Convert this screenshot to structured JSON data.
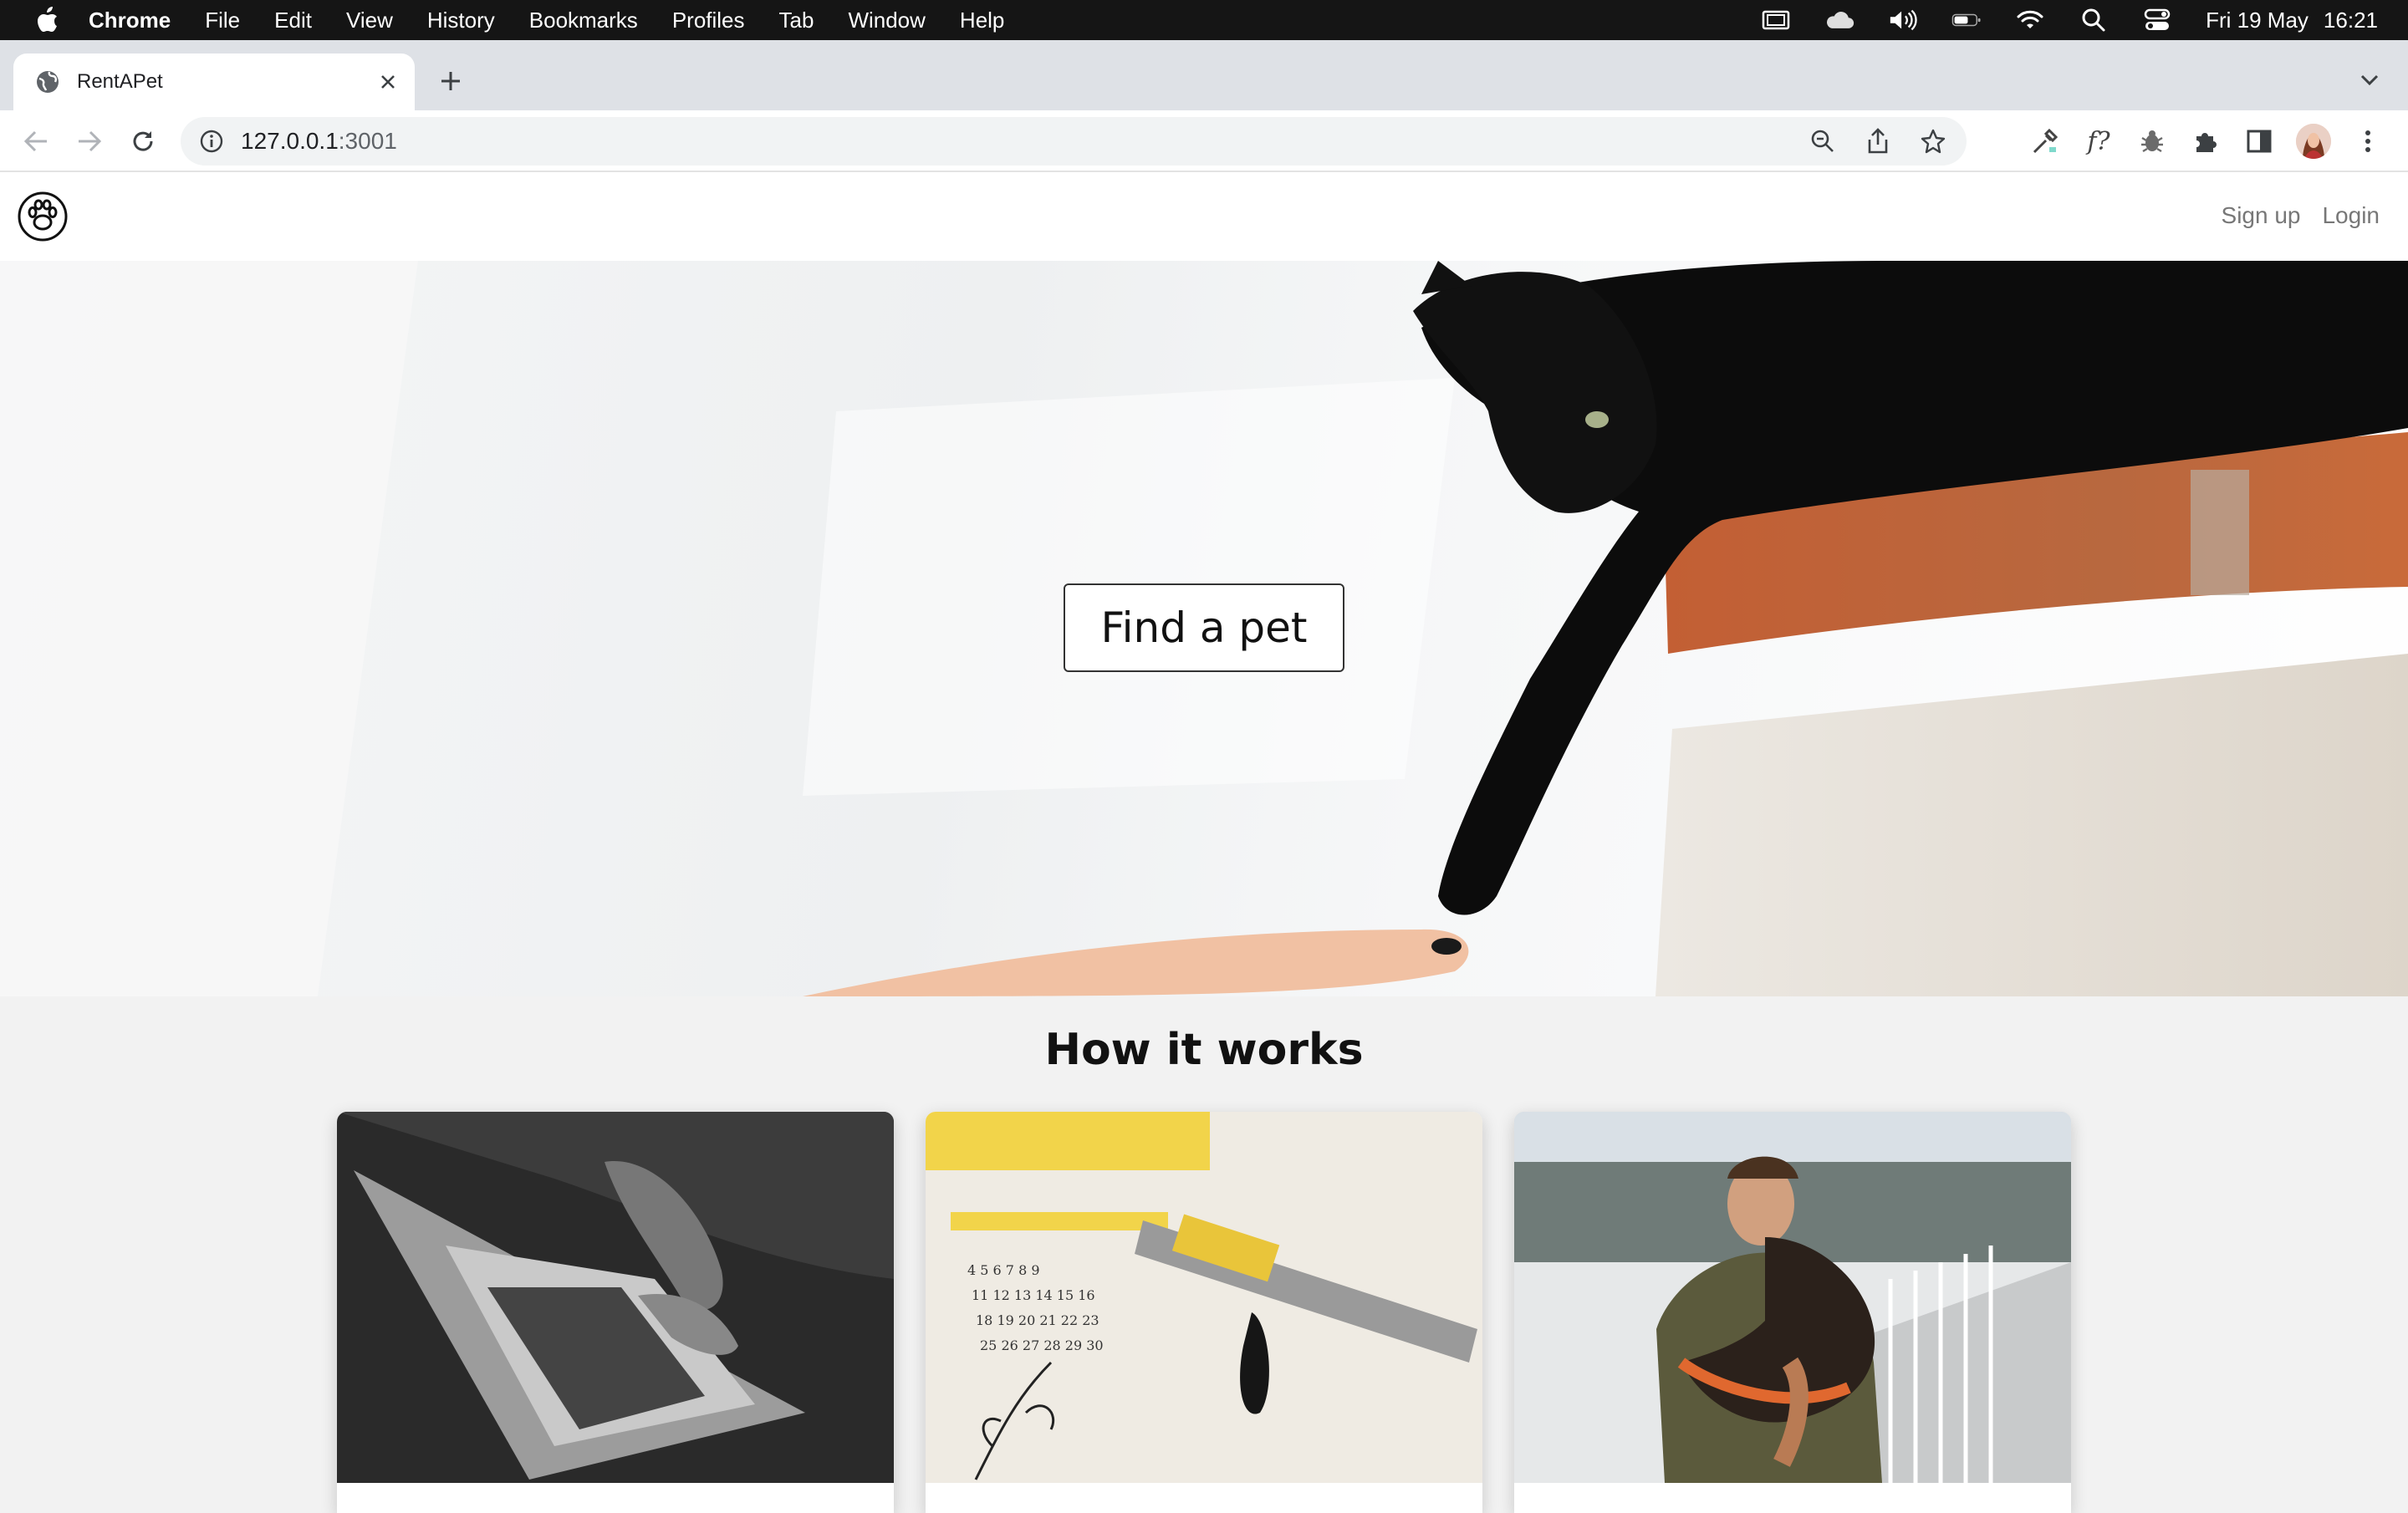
{
  "menubar": {
    "app_name": "Chrome",
    "items": [
      "File",
      "Edit",
      "View",
      "History",
      "Bookmarks",
      "Profiles",
      "Tab",
      "Window",
      "Help"
    ],
    "date": "Fri 19 May",
    "time": "16:21"
  },
  "browser": {
    "tab_title": "RentAPet",
    "url_host": "127.0.0.1",
    "url_port": ":3001"
  },
  "site": {
    "nav": {
      "signup": "Sign up",
      "login": "Login"
    },
    "hero": {
      "button": "Find a pet"
    },
    "how_it_works": {
      "title": "How it works"
    }
  },
  "colors": {
    "accent_text": "#111111",
    "nav_text": "#777777",
    "page_bg": "#f2f2f2",
    "brick": "#c4643a"
  }
}
